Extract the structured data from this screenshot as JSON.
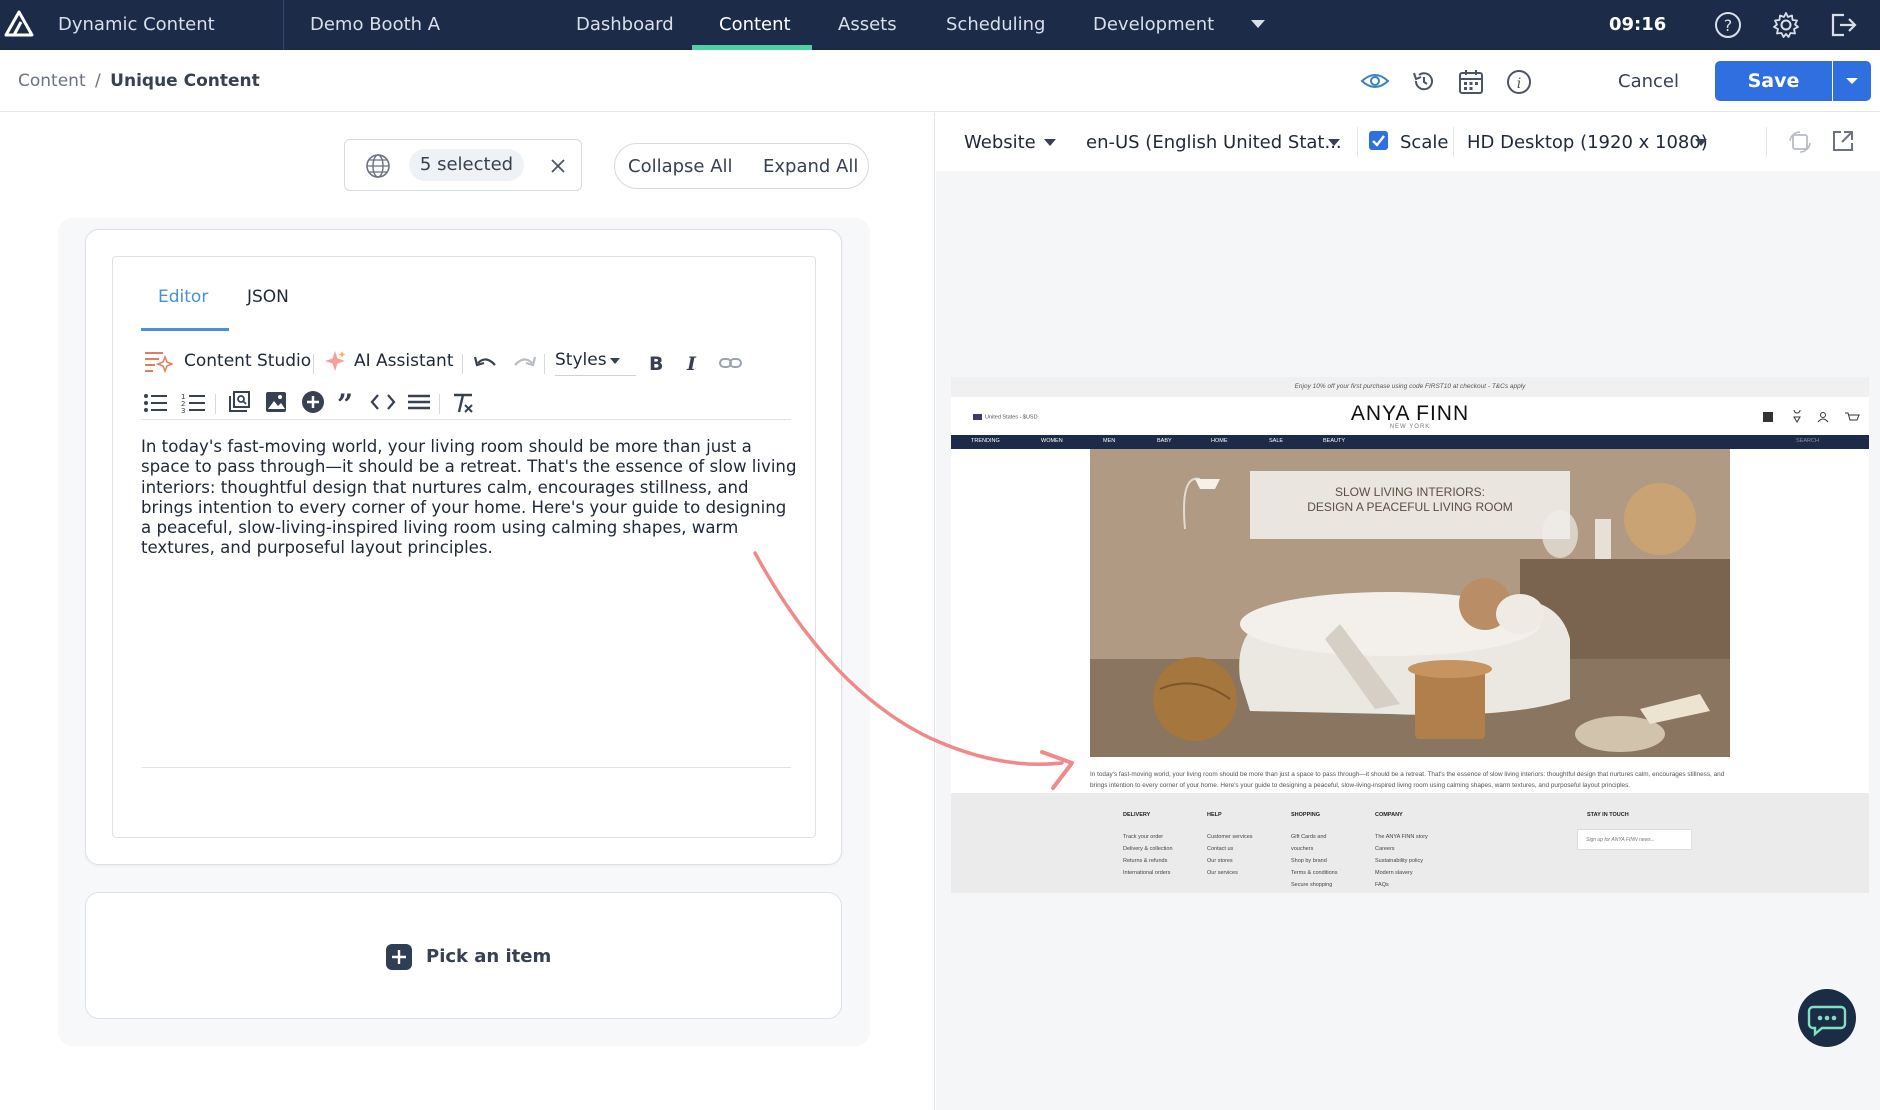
{
  "topbar": {
    "app_name": "Dynamic Content",
    "hub": "Demo Booth A",
    "nav": [
      "Dashboard",
      "Content",
      "Assets",
      "Scheduling",
      "Development"
    ],
    "active_nav": "Content",
    "time": "09:16"
  },
  "subheader": {
    "breadcrumb_root": "Content",
    "breadcrumb_sep": "/",
    "breadcrumb_current": "Unique Content",
    "cancel_label": "Cancel",
    "save_label": "Save"
  },
  "editor_panel": {
    "locale_selected": "5 selected",
    "collapse_all": "Collapse All",
    "expand_all": "Expand All",
    "tabs": [
      "Editor",
      "JSON"
    ],
    "toolbar": {
      "content_studio": "Content Studio",
      "ai_assistant": "AI Assistant",
      "styles": "Styles"
    },
    "body_text": "In today's fast-moving world, your living room should be more than just a space to pass through—it should be a retreat. That's the essence of slow living interiors: thoughtful design that nurtures calm, encourages stillness, and brings intention to every corner of your home.  Here's your guide to designing a peaceful, slow-living-inspired living room using calming shapes, warm textures, and purposeful layout principles.",
    "pick_item": "Pick an item"
  },
  "preview": {
    "channel": "Website",
    "locale": "en-US (English United Stat...",
    "scale_label": "Scale",
    "scale_checked": true,
    "device": "HD Desktop (1920 x 1080)",
    "site": {
      "promo": "Enjoy 10% off your first purchase using code FIRST10 at checkout - T&Cs apply",
      "region": "United States - $USD",
      "brand": "ANYA FINN",
      "brand_sub": "NEW YORK",
      "nav": [
        "TRENDING",
        "WOMEN",
        "MEN",
        "BABY",
        "HOME",
        "SALE",
        "BEAUTY"
      ],
      "search": "SEARCH",
      "hero_line1": "SLOW LIVING INTERIORS:",
      "hero_line2": "DESIGN A PEACEFUL LIVING ROOM",
      "body": "In today's fast-moving world, your living room should be more than just a space to pass through—it should be a retreat. That's the essence of slow living interiors: thoughtful design that nurtures calm, encourages stillness, and brings intention to every corner of your home. Here's your guide to designing a peaceful, slow-living-inspired living room using calming shapes, warm textures, and purposeful layout principles.",
      "footer": {
        "delivery": {
          "title": "DELIVERY",
          "items": [
            "Track your order",
            "Delivery & collection",
            "Returns & refunds",
            "International orders"
          ]
        },
        "help": {
          "title": "HELP",
          "items": [
            "Customer services",
            "Contact us",
            "Our stores",
            "Our services"
          ]
        },
        "shopping": {
          "title": "SHOPPING",
          "items": [
            "Gift Cards and",
            "vouchers",
            "Shop by brand",
            "Terms & conditions",
            "Secure shopping"
          ]
        },
        "company": {
          "title": "COMPANY",
          "items": [
            "The ANYA FINN story",
            "Careers",
            "Sustainability policy",
            "Modern slavery",
            "FAQs"
          ]
        },
        "stay": {
          "title": "STAY IN TOUCH",
          "placeholder": "Sign up for ANYA FINN news..."
        }
      }
    }
  },
  "colors": {
    "topbar": "#1c2b47",
    "accent": "#2f6fe0",
    "nav_active": "#4fd1a5",
    "arrow": "#f08a8a"
  }
}
